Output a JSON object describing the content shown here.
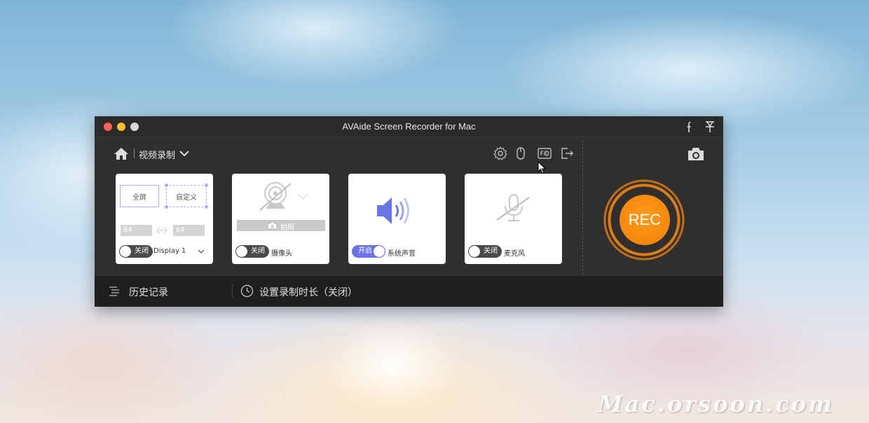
{
  "window": {
    "title": "AVAide Screen Recorder for Mac"
  },
  "toolbar": {
    "mode_label": "视频录制",
    "icons": [
      "settings-icon",
      "mouse-icon",
      "fps-icon",
      "export-icon"
    ]
  },
  "cards": {
    "display": {
      "fullscreen_label": "全屏",
      "custom_label": "自定义",
      "width_value": "64",
      "height_value": "64",
      "toggle_label": "关闭",
      "display_select": "Display 1"
    },
    "webcam": {
      "snapshot_label": "拍照",
      "toggle_label": "关闭",
      "name": "摄像头"
    },
    "system_audio": {
      "toggle_label": "开启",
      "name": "系统声音"
    },
    "microphone": {
      "toggle_label": "关闭",
      "name": "麦克风"
    }
  },
  "record": {
    "label": "REC"
  },
  "footer": {
    "history_label": "历史记录",
    "timer_label": "设置录制时长（关闭）"
  },
  "watermark": "Mac.orsoon.com",
  "colors": {
    "accent": "#f08a0c",
    "toggle_on": "#6b74e6"
  }
}
